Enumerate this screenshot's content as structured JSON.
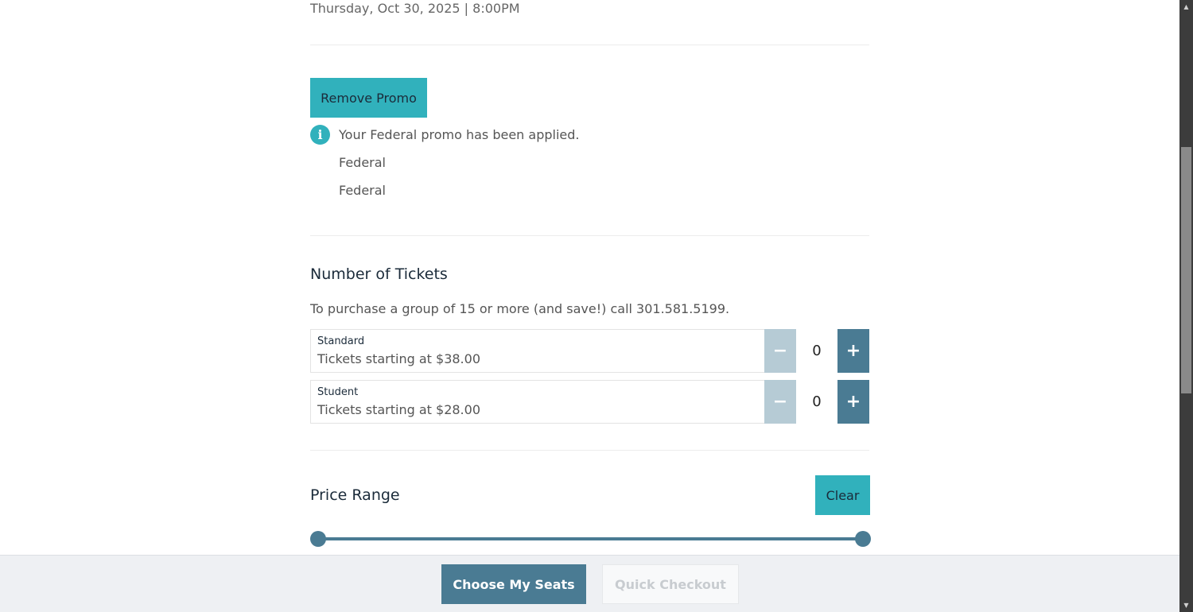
{
  "event": {
    "date_time": "Thursday, Oct 30, 2025 | 8:00PM"
  },
  "promo": {
    "remove_button": "Remove Promo",
    "message": "Your Federal promo has been applied.",
    "items": [
      "Federal",
      "Federal"
    ],
    "icon": "info-icon"
  },
  "tickets": {
    "title": "Number of Tickets",
    "group_note": "To purchase a group of 15 or more (and save!) call 301.581.5199.",
    "types": [
      {
        "name": "Standard",
        "price_text": "Tickets starting at $38.00",
        "quantity": "0"
      },
      {
        "name": "Student",
        "price_text": "Tickets starting at $28.00",
        "quantity": "0"
      }
    ],
    "minus_symbol": "−",
    "plus_symbol": "+"
  },
  "price_range": {
    "title": "Price Range",
    "clear_button": "Clear",
    "slider_min_fraction": 0,
    "slider_max_fraction": 1
  },
  "footer": {
    "choose_seats": "Choose My Seats",
    "quick_checkout": "Quick Checkout"
  },
  "colors": {
    "teal": "#31b1bc",
    "steel_blue": "#4a7b93",
    "disabled_blue": "#b6cbd5"
  }
}
